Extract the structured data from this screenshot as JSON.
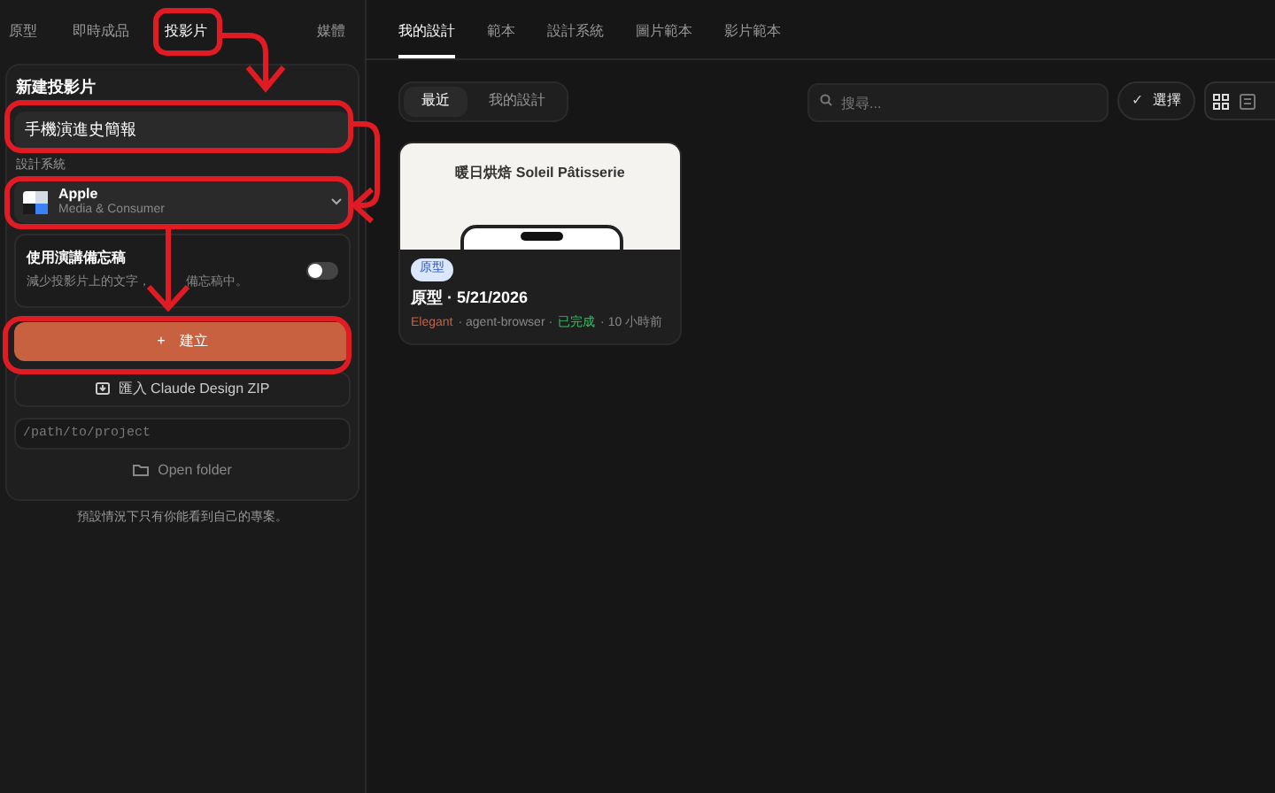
{
  "top_tabs": [
    {
      "label": "原型",
      "selected": false
    },
    {
      "label": "即時成品",
      "selected": false
    },
    {
      "label": "投影片",
      "selected": true
    },
    {
      "label": "媒體",
      "selected": false
    }
  ],
  "new_slide": {
    "heading": "新建投影片",
    "title_value": "手機演進史簡報",
    "design_system_label": "設計系統",
    "design_system": {
      "name": "Apple",
      "category": "Media & Consumer"
    },
    "speaker_notes": {
      "title": "使用演講備忘稿",
      "description_parts": [
        "減少投影片上的文字，",
        "備忘稿中。"
      ],
      "on": false
    },
    "create_button": {
      "icon": "+",
      "label": "建立"
    },
    "import_button": "匯入 Claude Design ZIP",
    "path_placeholder": "/path/to/project",
    "open_folder": "Open folder"
  },
  "footer_note": "預設情況下只有你能看到自己的專案。",
  "main_tabs": [
    {
      "label": "我的設計",
      "selected": true
    },
    {
      "label": "範本",
      "selected": false
    },
    {
      "label": "設計系統",
      "selected": false
    },
    {
      "label": "圖片範本",
      "selected": false
    },
    {
      "label": "影片範本",
      "selected": false
    }
  ],
  "filters": [
    {
      "label": "最近",
      "selected": true
    },
    {
      "label": "我的設計",
      "selected": false
    }
  ],
  "search": {
    "placeholder": "搜尋..."
  },
  "select_button": {
    "icon": "✓",
    "label": "選擇"
  },
  "view_modes": [
    {
      "kind": "grid",
      "selected": true
    },
    {
      "kind": "list",
      "selected": false
    }
  ],
  "designs": [
    {
      "preview_title": "暖日烘焙 Soleil Pâtisserie",
      "badge": "原型",
      "title": "原型 · 5/21/2026",
      "meta": [
        {
          "kind": "tag",
          "text": "Elegant"
        },
        {
          "kind": "plain",
          "text": "· agent-browser ·"
        },
        {
          "kind": "status",
          "text": "已完成"
        },
        {
          "kind": "plain",
          "text": "· 10 小時前"
        }
      ]
    }
  ]
}
